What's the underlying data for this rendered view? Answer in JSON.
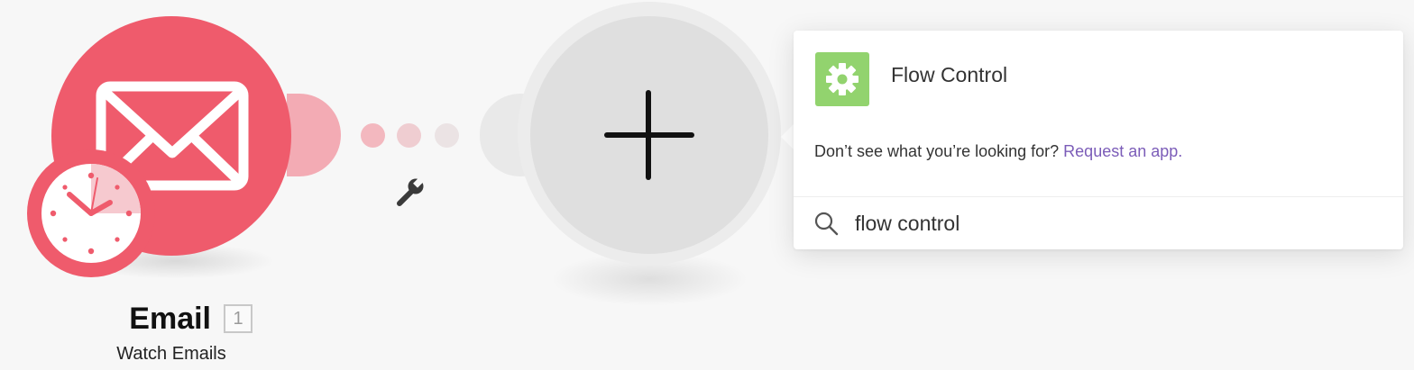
{
  "email_module": {
    "title": "Email",
    "index": "1",
    "subtitle": "Watch Emails",
    "main_icon": "envelope-icon",
    "badge_icon": "clock-icon",
    "color": "#ef5b6c"
  },
  "connection": {
    "settings_icon": "wrench-icon"
  },
  "add_module": {
    "icon": "plus-icon"
  },
  "app_search": {
    "results": [
      {
        "label": "Flow Control",
        "icon": "gear-icon",
        "icon_color": "#92d36e"
      }
    ],
    "missing_text": "Don’t see what you’re looking for?",
    "request_link": "Request an app.",
    "search_value": "flow control",
    "search_icon": "search-icon",
    "link_color": "#7b5cb8"
  }
}
